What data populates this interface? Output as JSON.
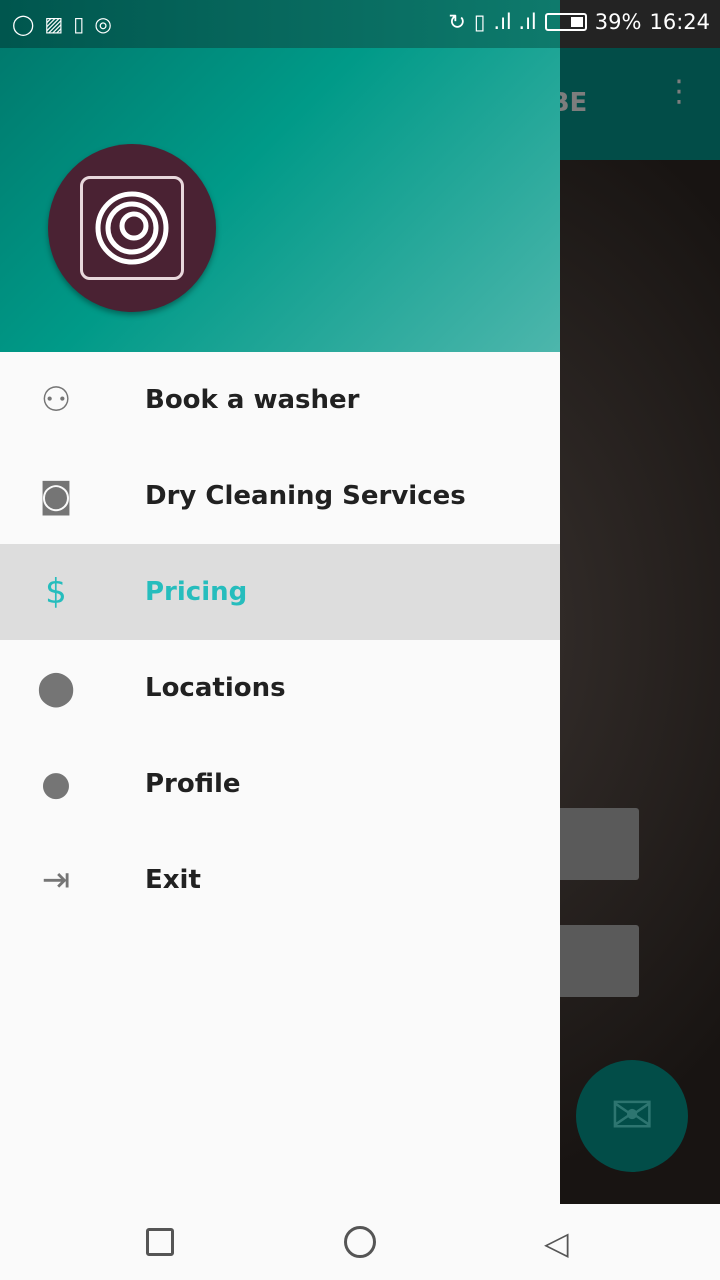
{
  "status_bar": {
    "battery": "39%",
    "time": "16:24",
    "battery_level": 0.39
  },
  "app_bar": {
    "action_label": "RIBE",
    "overflow_icon": "more-vert-icon"
  },
  "drawer": {
    "items": [
      {
        "label": "Book a washer",
        "icon": "person-outline-icon"
      },
      {
        "label": "Dry Cleaning Services",
        "icon": "washing-machine-icon"
      },
      {
        "label": "Pricing",
        "icon": "dollar-icon",
        "active": true
      },
      {
        "label": "Locations",
        "icon": "location-pin-icon"
      },
      {
        "label": "Profile",
        "icon": "person-icon"
      },
      {
        "label": "Exit",
        "icon": "exit-icon"
      }
    ]
  },
  "colors": {
    "accent": "#26bdbd",
    "header": "#009a88",
    "avatar": "#4a2233"
  }
}
